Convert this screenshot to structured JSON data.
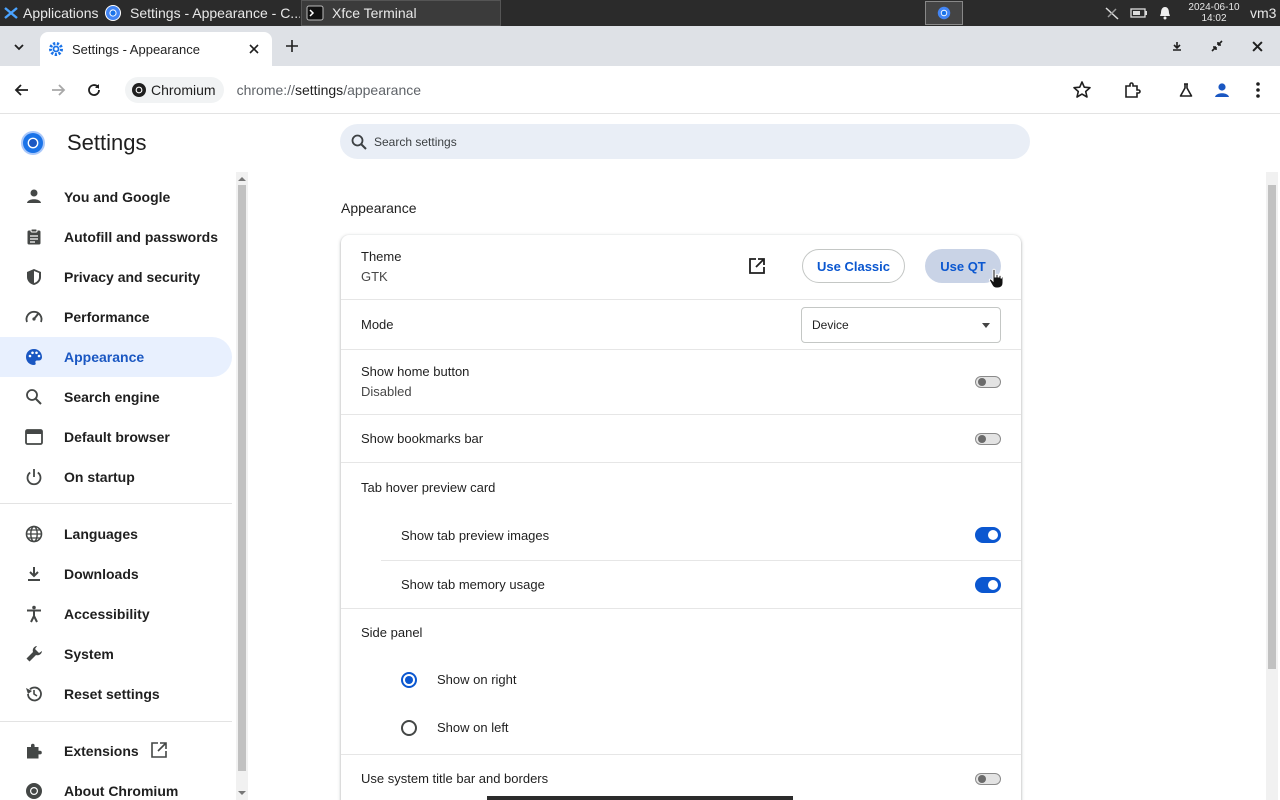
{
  "os_panel": {
    "applications_label": "Applications",
    "tasks": [
      {
        "title": "Settings - Appearance - C..."
      },
      {
        "title": "Xfce Terminal"
      }
    ],
    "clock_date": "2024-06-10",
    "clock_time": "14:02",
    "user": "vm3"
  },
  "browser": {
    "active_tab_title": "Settings - Appearance",
    "site_chip": "Chromium",
    "url_scheme": "chrome://",
    "url_host": "settings",
    "url_path": "/appearance"
  },
  "settings": {
    "title": "Settings",
    "search_placeholder": "Search settings",
    "nav": [
      {
        "label": "You and Google",
        "icon": "person-icon"
      },
      {
        "label": "Autofill and passwords",
        "icon": "clipboard-icon"
      },
      {
        "label": "Privacy and security",
        "icon": "shield-icon"
      },
      {
        "label": "Performance",
        "icon": "speedometer-icon"
      },
      {
        "label": "Appearance",
        "icon": "palette-icon"
      },
      {
        "label": "Search engine",
        "icon": "search-icon"
      },
      {
        "label": "Default browser",
        "icon": "browser-window-icon"
      },
      {
        "label": "On startup",
        "icon": "power-icon"
      },
      {
        "label": "Languages",
        "icon": "globe-icon"
      },
      {
        "label": "Downloads",
        "icon": "download-icon"
      },
      {
        "label": "Accessibility",
        "icon": "accessibility-icon"
      },
      {
        "label": "System",
        "icon": "wrench-icon"
      },
      {
        "label": "Reset settings",
        "icon": "history-icon"
      },
      {
        "label": "Extensions",
        "icon": "puzzle-icon"
      },
      {
        "label": "About Chromium",
        "icon": "chromium-icon"
      }
    ],
    "active_nav": "Appearance",
    "section_title": "Appearance",
    "theme": {
      "label": "Theme",
      "value": "GTK",
      "use_classic": "Use Classic",
      "use_qt": "Use QT"
    },
    "mode": {
      "label": "Mode",
      "value": "Device"
    },
    "home_button": {
      "label": "Show home button",
      "sub": "Disabled",
      "on": false
    },
    "bookmarks_bar": {
      "label": "Show bookmarks bar",
      "on": false
    },
    "tab_hover": {
      "label": "Tab hover preview card",
      "preview_images": {
        "label": "Show tab preview images",
        "on": true
      },
      "memory_usage": {
        "label": "Show tab memory usage",
        "on": true
      }
    },
    "side_panel": {
      "label": "Side panel",
      "options": [
        {
          "label": "Show on right",
          "selected": true
        },
        {
          "label": "Show on left",
          "selected": false
        }
      ]
    },
    "system_title_bar": {
      "label": "Use system title bar and borders",
      "on": false
    }
  },
  "colors": {
    "accent": "#0b57d0",
    "nav_active_bg": "#e8f0fe",
    "panel_bg": "#2b2b2b",
    "tab_strip_bg": "#dee1e6"
  }
}
